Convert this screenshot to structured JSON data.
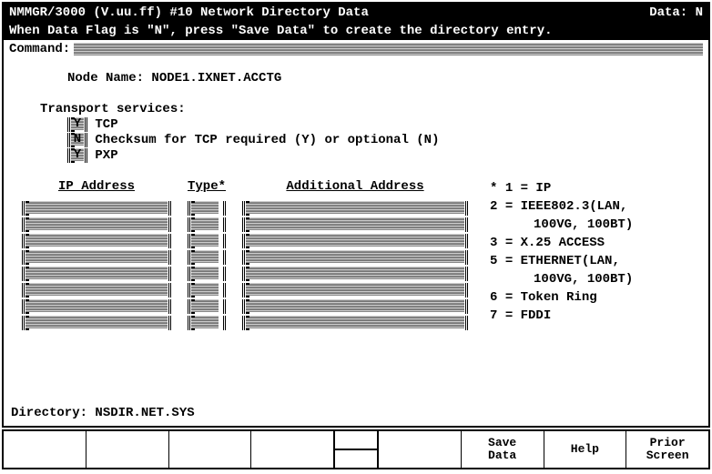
{
  "title": "NMMGR/3000 (V.uu.ff) #10  Network Directory Data",
  "data_flag_label": "Data: N",
  "hint": "When Data Flag is \"N\", press \"Save Data\" to create the directory entry.",
  "command_label": "Command:",
  "command_value": "",
  "node_name_label": "Node Name:",
  "node_name_value": "NODE1.IXNET.ACCTG",
  "transport_label": "Transport services:",
  "transport": [
    {
      "flag": "Y",
      "label": "TCP"
    },
    {
      "flag": "N",
      "label": "Checksum for TCP required (Y) or optional (N)"
    },
    {
      "flag": "Y",
      "label": "PXP"
    }
  ],
  "columns": {
    "ip": "IP Address",
    "type": "Type*",
    "addl": "Additional Address"
  },
  "rows": [
    {
      "ip": "",
      "type": "",
      "addl": ""
    },
    {
      "ip": "",
      "type": "",
      "addl": ""
    },
    {
      "ip": "",
      "type": "",
      "addl": ""
    },
    {
      "ip": "",
      "type": "",
      "addl": ""
    },
    {
      "ip": "",
      "type": "",
      "addl": ""
    },
    {
      "ip": "",
      "type": "",
      "addl": ""
    },
    {
      "ip": "",
      "type": "",
      "addl": ""
    },
    {
      "ip": "",
      "type": "",
      "addl": ""
    }
  ],
  "legend": [
    "* 1 = IP",
    "  2 = IEEE802.3(LAN,",
    "      100VG, 100BT)",
    "  3 = X.25 ACCESS",
    "  5 = ETHERNET(LAN,",
    "      100VG, 100BT)",
    "  6 = Token Ring",
    "  7 = FDDI"
  ],
  "directory_label": "Directory:",
  "directory_value": "NSDIR.NET.SYS",
  "softkeys_left": [
    "",
    "",
    "",
    ""
  ],
  "softkeys_right": [
    "",
    "Save Data",
    "Help",
    "Prior Screen"
  ]
}
